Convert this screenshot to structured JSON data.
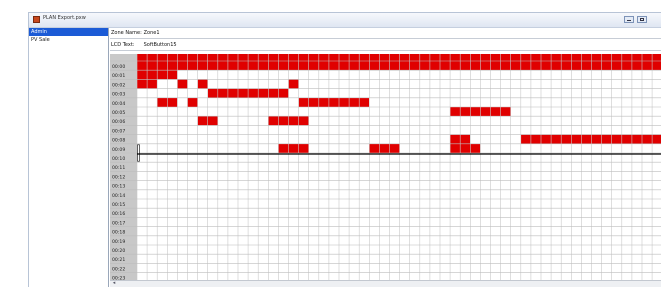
{
  "window": {
    "title": "PLAN Export.pxw",
    "controls": {
      "minimize": "minimize-icon",
      "maximize": "maximize-icon"
    }
  },
  "sidebar": {
    "items": [
      {
        "label": "Admin",
        "selected": true
      },
      {
        "label": "PV Sale",
        "selected": false
      }
    ]
  },
  "info": {
    "zone_label": "Zone Name:",
    "zone_value": "Zone1",
    "lcd_label": "LCD Text:",
    "lcd_value": "SoftButton15"
  },
  "grid": {
    "row_labels": [
      "00:00",
      "00:01",
      "00:02",
      "00:03",
      "00:04",
      "00:05",
      "00:06",
      "00:07",
      "00:08",
      "00:09",
      "00:10",
      "00:11",
      "00:12",
      "00:13",
      "00:14",
      "00:15",
      "00:16",
      "00:17",
      "00:18",
      "00:19",
      "00:20",
      "00:21",
      "00:22",
      "00:23"
    ],
    "column_count": 52,
    "colors": {
      "cell_on": "#e00000",
      "grid_line": "#c9c9c9",
      "header_bg": "#c9c9c9",
      "row_header_bg": "#c8c8c8",
      "row_header_selected_bg": "#3a3a3a",
      "cursor_line": "#000000"
    },
    "filled_segments": [
      {
        "row": -1,
        "start": 0,
        "end": 51
      },
      {
        "row": 0,
        "start": 0,
        "end": 51
      },
      {
        "row": 1,
        "start": 0,
        "end": 3
      },
      {
        "row": 2,
        "start": 0,
        "end": 1
      },
      {
        "row": 2,
        "start": 4,
        "end": 4
      },
      {
        "row": 2,
        "start": 6,
        "end": 6
      },
      {
        "row": 2,
        "start": 15,
        "end": 15
      },
      {
        "row": 3,
        "start": 7,
        "end": 14
      },
      {
        "row": 4,
        "start": 2,
        "end": 3
      },
      {
        "row": 4,
        "start": 5,
        "end": 5
      },
      {
        "row": 4,
        "start": 16,
        "end": 22
      },
      {
        "row": 5,
        "start": 31,
        "end": 36
      },
      {
        "row": 6,
        "start": 6,
        "end": 7
      },
      {
        "row": 6,
        "start": 13,
        "end": 16
      },
      {
        "row": 8,
        "start": 31,
        "end": 32
      },
      {
        "row": 8,
        "start": 38,
        "end": 51
      },
      {
        "row": 9,
        "start": 14,
        "end": 16
      },
      {
        "row": 9,
        "start": 23,
        "end": 25
      },
      {
        "row": 9,
        "start": 31,
        "end": 33
      }
    ],
    "selected_row": 10
  }
}
